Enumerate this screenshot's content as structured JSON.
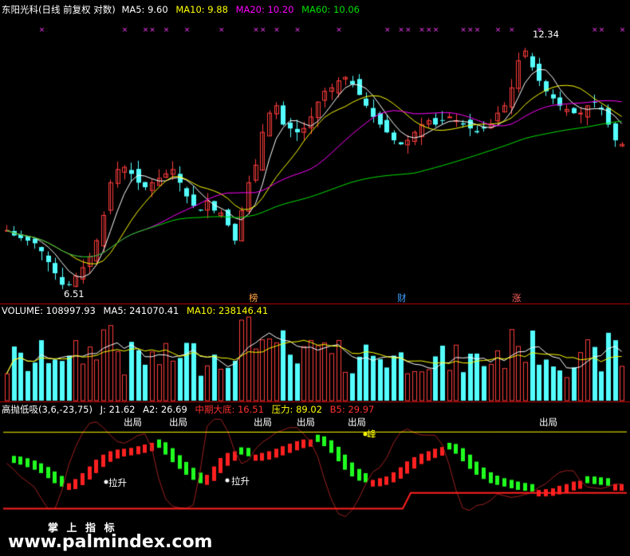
{
  "panels": {
    "price": {
      "title": "东阳光科(日线 前复权 对数)",
      "legend": [
        {
          "label": "MA5: 9.60",
          "color": "#ffffff"
        },
        {
          "label": "MA10: 9.88",
          "color": "#ffff00"
        },
        {
          "label": "MA20: 10.20",
          "color": "#ff00ff"
        },
        {
          "label": "MA60: 10.06",
          "color": "#00e000"
        }
      ],
      "annotations": {
        "high": "12.34",
        "low": "6.51"
      },
      "markers": [
        {
          "label": "榜",
          "color": "#ffa040"
        },
        {
          "label": "财",
          "color": "#40a0ff"
        },
        {
          "label": "涨",
          "color": "#ff6060"
        }
      ]
    },
    "volume": {
      "legend": [
        {
          "label": "VOLUME: 108997.93",
          "color": "#ffffff"
        },
        {
          "label": "MA5: 241070.41",
          "color": "#ffffff"
        },
        {
          "label": "MA10: 238146.41",
          "color": "#ffff00"
        }
      ]
    },
    "indicator": {
      "legend": [
        {
          "label": "高抛低吸(3,6,-23,75)",
          "color": "#ffffff"
        },
        {
          "label": "J: 21.62",
          "color": "#ffffff"
        },
        {
          "label": "A2: 26.69",
          "color": "#ffffff"
        },
        {
          "label": "中期大底: 16.51",
          "color": "#ff3030"
        },
        {
          "label": "压力: 89.02",
          "color": "#ffff00"
        },
        {
          "label": "B5: 29.97",
          "color": "#ff3030"
        }
      ],
      "labels": {
        "sell": "出局",
        "buy": "拉升",
        "peak": "峰"
      }
    }
  },
  "watermark": {
    "cn": "掌 上 指 标",
    "url": "www.palmindex.com"
  },
  "chart_data": [
    {
      "type": "candlestick",
      "title": "东阳光科(日线 前复权 对数)",
      "log_scale": true,
      "ylim": [
        6.3,
        13.2
      ],
      "close_path": [
        7.6,
        7.5,
        7.45,
        7.4,
        7.35,
        7.2,
        7.0,
        6.8,
        6.6,
        6.6,
        6.75,
        6.9,
        7.1,
        7.4,
        7.9,
        8.6,
        8.9,
        8.95,
        8.8,
        8.6,
        8.5,
        8.6,
        8.7,
        8.8,
        8.9,
        8.6,
        8.3,
        8.1,
        8.0,
        8.2,
        8.0,
        7.95,
        7.7,
        7.4,
        8.0,
        8.6,
        9.0,
        9.8,
        10.3,
        10.5,
        10.0,
        9.9,
        9.8,
        9.9,
        10.2,
        10.6,
        10.9,
        11.0,
        11.2,
        11.3,
        11.1,
        10.8,
        10.5,
        10.2,
        10.0,
        9.8,
        9.6,
        9.5,
        9.6,
        9.8,
        10.0,
        10.1,
        10.0,
        10.1,
        10.2,
        10.1,
        10.0,
        9.9,
        9.8,
        9.9,
        10.0,
        10.3,
        10.5,
        11.0,
        11.8,
        12.1,
        11.6,
        11.2,
        10.9,
        10.7,
        10.5,
        10.4,
        10.3,
        10.3,
        10.5,
        10.6,
        10.4,
        10.0,
        9.6,
        9.5
      ],
      "annotations": [
        {
          "label": "12.34",
          "type": "high"
        },
        {
          "label": "6.51",
          "type": "low"
        }
      ],
      "series": [
        {
          "name": "MA5",
          "last": 9.6
        },
        {
          "name": "MA10",
          "last": 9.88
        },
        {
          "name": "MA20",
          "last": 10.2
        },
        {
          "name": "MA60",
          "last": 10.06
        }
      ]
    },
    {
      "type": "bar",
      "series": [
        {
          "name": "VOLUME",
          "last": 108997.93
        },
        {
          "name": "MA5",
          "last": 241070.41
        },
        {
          "name": "MA10",
          "last": 238146.41
        }
      ]
    },
    {
      "type": "line",
      "title": "高抛低吸(3,6,-23,75)",
      "ylim": [
        -30,
        110
      ],
      "series": [
        {
          "name": "J",
          "last": 21.62
        },
        {
          "name": "A2",
          "last": 26.69
        },
        {
          "name": "中期大底",
          "last": 16.51
        },
        {
          "name": "压力",
          "last": 89.02
        },
        {
          "name": "B5",
          "last": 29.97
        }
      ],
      "a2_path": [
        55,
        54,
        52,
        49,
        46,
        42,
        36,
        30,
        26,
        28,
        33,
        40,
        48,
        56,
        62,
        66,
        68,
        69,
        70,
        72,
        74,
        76,
        72,
        64,
        55,
        47,
        40,
        34,
        30,
        38,
        48,
        58,
        64,
        66,
        64,
        62,
        62,
        64,
        66,
        69,
        72,
        75,
        78,
        80,
        80,
        79,
        74,
        66,
        56,
        46,
        38,
        33,
        31,
        32,
        34,
        36,
        41,
        47,
        54,
        59,
        63,
        66,
        69,
        71,
        70,
        65,
        56,
        47,
        40,
        35,
        30,
        28,
        26,
        24,
        22,
        21,
        20,
        20,
        21,
        22,
        25,
        27,
        30,
        31,
        30,
        29,
        28,
        27,
        27,
        27
      ]
    }
  ]
}
